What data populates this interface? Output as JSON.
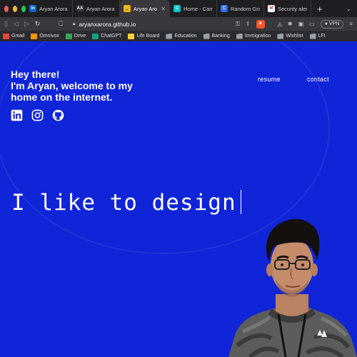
{
  "browser": {
    "tabs": [
      {
        "title": "Aryan Arora |",
        "fav": "in",
        "fav_color": "#0a66c2"
      },
      {
        "title": "Aryan Arora",
        "fav": "AA",
        "fav_color": "#333333"
      },
      {
        "title": "Aryan Aro",
        "fav": "😀",
        "fav_color": "#f4b400",
        "active": true
      },
      {
        "title": "Home - Canva",
        "fav": "C",
        "fav_color": "#00c4cc"
      },
      {
        "title": "Random Grap",
        "fav": "C",
        "fav_color": "#2f6fed"
      },
      {
        "title": "Security alert",
        "fav": "M",
        "fav_color": "#ffffff"
      }
    ],
    "close_glyph": "✕",
    "new_tab": "+",
    "url": "aryanxarora.github.io",
    "vpn_label": "VPN",
    "bookmarks": [
      {
        "label": "Gmail",
        "kind": "gmail"
      },
      {
        "label": "Omnivox",
        "kind": "omnivox"
      },
      {
        "label": "Drive",
        "kind": "drive"
      },
      {
        "label": "ChatGPT",
        "kind": "chatgpt"
      },
      {
        "label": "Life Board",
        "kind": "miro"
      },
      {
        "label": "Education",
        "kind": "folder"
      },
      {
        "label": "Banking",
        "kind": "folder"
      },
      {
        "label": "Immigration",
        "kind": "folder"
      },
      {
        "label": "Wishlist",
        "kind": "folder"
      },
      {
        "label": "LFI",
        "kind": "folder"
      }
    ]
  },
  "site": {
    "greeting_line1": "Hey there!",
    "greeting_line2": "I'm Aryan, welcome to my",
    "greeting_line3": "home on the internet.",
    "nav_resume": "resume",
    "nav_contact": "contact",
    "hero_text": "I like to design",
    "social_icons": [
      "linkedin-icon",
      "instagram-icon",
      "github-icon"
    ],
    "background_color": "#1025d8"
  }
}
